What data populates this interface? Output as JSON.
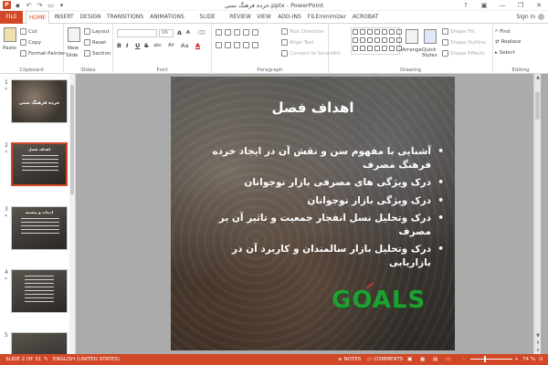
{
  "title_bar": {
    "document_title": "خرده فرهنگ سنی.pptx - PowerPoint",
    "app_icon": "P"
  },
  "window": {
    "minimize": "—",
    "restore": "❐",
    "close": "✕",
    "help": "?"
  },
  "tabs": [
    "FILE",
    "HOME",
    "INSERT",
    "DESIGN",
    "TRANSITIONS",
    "ANIMATIONS",
    "SLIDE SHOW",
    "REVIEW",
    "VIEW",
    "ADD-INS",
    "FILEminimizer",
    "ACROBAT"
  ],
  "active_tab": "HOME",
  "sign_in": "Sign in",
  "ribbon": {
    "clipboard": {
      "label": "Clipboard",
      "paste": "Paste",
      "cut": "Cut",
      "copy": "Copy",
      "format_painter": "Format Painter"
    },
    "slides": {
      "label": "Slides",
      "new_slide": "New",
      "new_slide2": "Slide",
      "layout": "Layout",
      "reset": "Reset",
      "section": "Section"
    },
    "font": {
      "label": "Font",
      "font_name": "",
      "font_size": "96",
      "bold": "B",
      "italic": "I",
      "underline": "U",
      "strike": "S",
      "shadow": "abc",
      "spacing": "AV",
      "case": "Aa",
      "color": "A"
    },
    "paragraph": {
      "label": "Paragraph",
      "text_direction": "Text Direction",
      "align_text": "Align Text",
      "convert_smartart": "Convert to SmartArt"
    },
    "drawing": {
      "label": "Drawing",
      "arrange": "Arrange",
      "quick_styles": "Quick Styles",
      "shape_fill": "Shape Fill",
      "shape_outline": "Shape Outline",
      "shape_effects": "Shape Effects"
    },
    "editing": {
      "label": "Editing",
      "find": "Find",
      "replace": "Replace",
      "select": "Select"
    }
  },
  "thumbnails": [
    {
      "num": "1",
      "title": "خرده فرهنگ سنی",
      "star": "*"
    },
    {
      "num": "2",
      "title": "اهداف فصل",
      "star": "*",
      "selected": true
    },
    {
      "num": "3",
      "title": "ادبیات و پیشینه",
      "star": "*"
    },
    {
      "num": "4",
      "title": "",
      "star": "*"
    },
    {
      "num": "5",
      "title": "",
      "star": ""
    }
  ],
  "slide": {
    "title": "اهداف فصل",
    "bullets": [
      "آشنایی با مفهوم سن و نقش آن در ایجاد خرده فرهنگ مصرف",
      "درک ویژگی های مصرفی بازار نوجوانان",
      "درک ویژگی بازار نوجوانان",
      "درک وتحلیل نسل انفجار جمعیت و تاثیر آن بر مصرف",
      "درک وتحلیل بازار سالمندان و کاربرد آن در بازاریابی"
    ],
    "goals_graphic": "GOALS"
  },
  "status": {
    "slide_of": "SLIDE 2 OF 31",
    "language": "ENGLISH (UNITED STATES)",
    "notes": "NOTES",
    "comments": "COMMENTS",
    "zoom": "74 %",
    "zoom_level": 0.74,
    "zoom_minus": "-",
    "zoom_plus": "+"
  },
  "colors": {
    "accent": "#d24726",
    "status_bg": "#d24726",
    "goals": "#1fa033"
  }
}
